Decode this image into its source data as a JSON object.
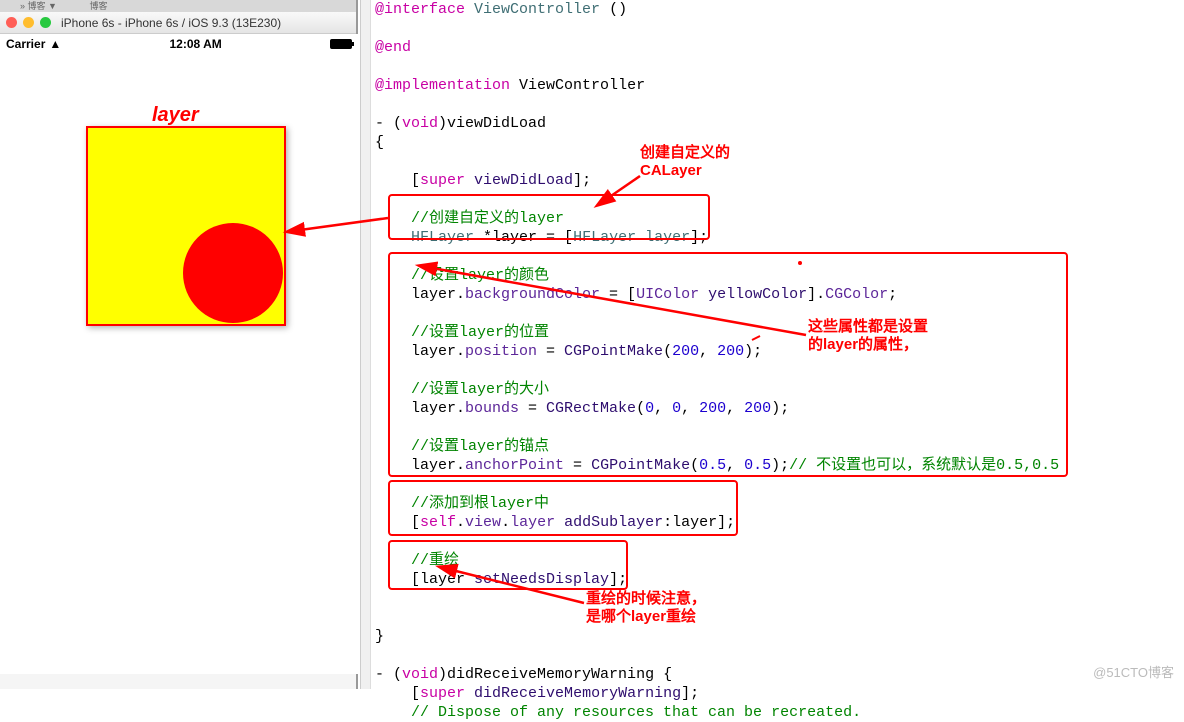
{
  "browser_tabs": {
    "tab1": "» 博客 ▼",
    "tab2": "博客"
  },
  "simulator": {
    "title": "iPhone 6s - iPhone 6s / iOS 9.3 (13E230)",
    "status": {
      "carrier": "Carrier",
      "time": "12:08 AM"
    }
  },
  "labels": {
    "layer": "layer",
    "create_calayer": "创建自定义的\nCALayer",
    "layer_props": "这些属性都是设置\n的layer的属性，",
    "redraw_note": "重绘的时候注意，\n是哪个layer重绘"
  },
  "code": {
    "l1a": "@interface",
    "l1b": "ViewController",
    "l1c": "()",
    "l2": "@end",
    "l3": "@implementation",
    "l3b": "ViewController",
    "l4a": "- (",
    "l4b": "void",
    "l4c": ")viewDidLoad",
    "l5": "{",
    "l6a": "    [",
    "l6b": "super",
    "l6c": "viewDidLoad",
    "l6d": "];",
    "l7": "    //创建自定义的layer",
    "l8a": "    ",
    "l8b": "HFLayer",
    "l8c": " *layer = [",
    "l8d": "HFLayer",
    "l8e": "layer",
    "l8f": "];",
    "l9": "    //设置layer的颜色",
    "l10a": "    layer.",
    "l10b": "backgroundColor",
    "l10c": " = [",
    "l10d": "UIColor",
    "l10e": "yellowColor",
    "l10f": "].",
    "l10g": "CGColor",
    "l10h": ";",
    "l11": "    //设置layer的位置",
    "l12a": "    layer.",
    "l12b": "position",
    "l12c": " = ",
    "l12d": "CGPointMake",
    "l12e": "(",
    "l12f": "200",
    "l12g": ", ",
    "l12h": "200",
    "l12i": ");",
    "l13": "    //设置layer的大小",
    "l14a": "    layer.",
    "l14b": "bounds",
    "l14c": " = ",
    "l14d": "CGRectMake",
    "l14e": "(",
    "l14f": "0",
    "l14g": ", ",
    "l14h": "0",
    "l14i": ", ",
    "l14j": "200",
    "l14k": ", ",
    "l14l": "200",
    "l14m": ");",
    "l15": "    //设置layer的锚点",
    "l16a": "    layer.",
    "l16b": "anchorPoint",
    "l16c": " = ",
    "l16d": "CGPointMake",
    "l16e": "(",
    "l16f": "0.5",
    "l16g": ", ",
    "l16h": "0.5",
    "l16i": ");",
    "l16j": "// 不设置也可以，系统默认是0.5,0.5",
    "l17": "    //添加到根layer中",
    "l18a": "    [",
    "l18b": "self",
    "l18c": ".",
    "l18d": "view",
    "l18e": ".",
    "l18f": "layer",
    "l18g": "addSublayer",
    "l18h": ":layer];",
    "l19": "    //重绘",
    "l20a": "    [layer ",
    "l20b": "setNeedsDisplay",
    "l20c": "];",
    "l21": "}",
    "l22a": "- (",
    "l22b": "void",
    "l22c": ")didReceiveMemoryWarning {",
    "l23a": "    [",
    "l23b": "super",
    "l23c": "didReceiveMemoryWarning",
    "l23d": "];",
    "l24": "    // Dispose of any resources that can be recreated."
  },
  "watermark": "@51CTO博客"
}
